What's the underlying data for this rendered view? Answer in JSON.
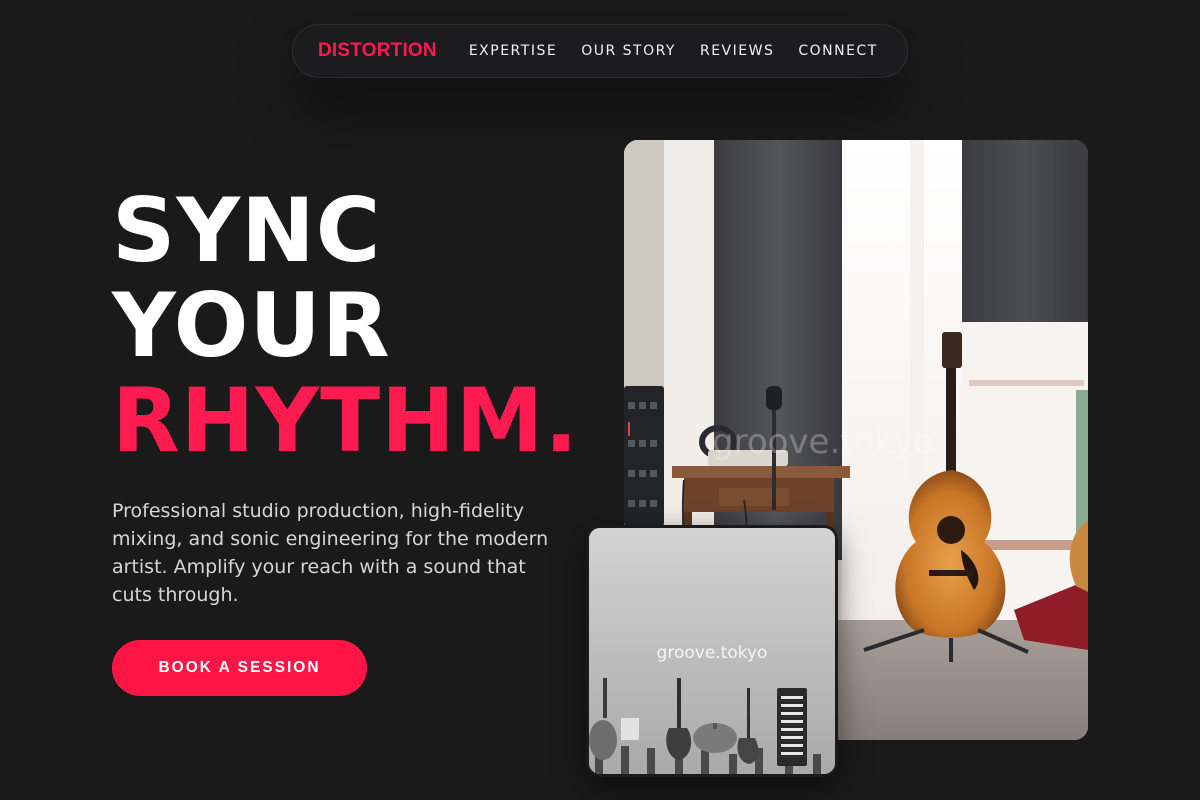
{
  "nav": {
    "brand": "DISTORTION",
    "links": [
      "EXPERTISE",
      "OUR STORY",
      "REVIEWS",
      "CONNECT"
    ]
  },
  "hero": {
    "headline_line1": "SYNC",
    "headline_line2": "YOUR",
    "headline_line3": "RHYTHM.",
    "subtitle": "Professional studio production, high-fidelity mixing, and sonic engineering for the modern artist. Amplify your reach with a sound that cuts through.",
    "cta_label": "BOOK A SESSION"
  },
  "images": {
    "main_watermark": "groove.tokyo",
    "secondary_watermark": "groove.tokyo"
  },
  "colors": {
    "background": "#1a1a1b",
    "accent": "#ff1a4f",
    "text_primary": "#ffffff",
    "text_secondary": "#d6d6d8"
  }
}
